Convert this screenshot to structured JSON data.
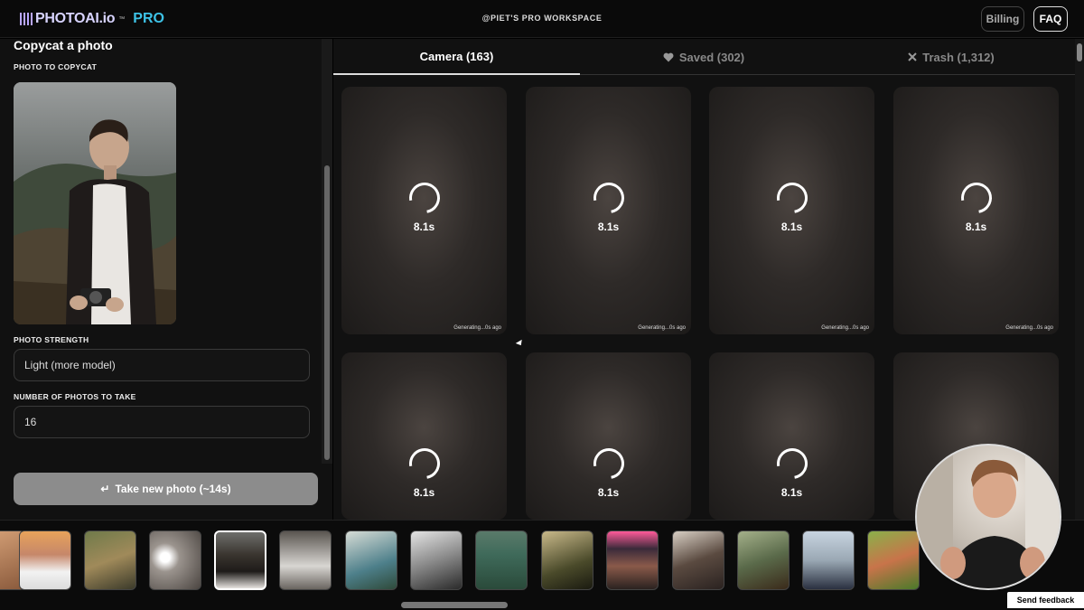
{
  "header": {
    "logo_text": "PHOTOAI.io",
    "logo_tm": "™",
    "logo_pro": "PRO",
    "workspace": "@PIET'S PRO WORKSPACE",
    "billing_label": "Billing",
    "faq_label": "FAQ"
  },
  "left_panel": {
    "title": "Copycat a photo",
    "photo_label": "PHOTO TO COPYCAT",
    "strength_label": "PHOTO STRENGTH",
    "strength_value": "Light (more model)",
    "count_label": "NUMBER OF PHOTOS TO TAKE",
    "count_value": "16",
    "take_button_icon": "↵",
    "take_button_label": "Take new photo (~14s)"
  },
  "tabs": [
    {
      "label": "Camera (163)",
      "icon": "",
      "active": true
    },
    {
      "label": "Saved (302)",
      "icon": "heart-icon",
      "active": false
    },
    {
      "label": "Trash (1,312)",
      "icon": "x-icon",
      "active": false
    }
  ],
  "grid": {
    "timer": "8.1s",
    "generating": "Generating...0s ago"
  },
  "strip": {
    "selected_index": 4
  },
  "feedback_label": "Send feedback",
  "colors": {
    "accent_pro": "#3dc2e6",
    "logo": "#d8d4ff",
    "button_grey": "#8c8c8c"
  }
}
